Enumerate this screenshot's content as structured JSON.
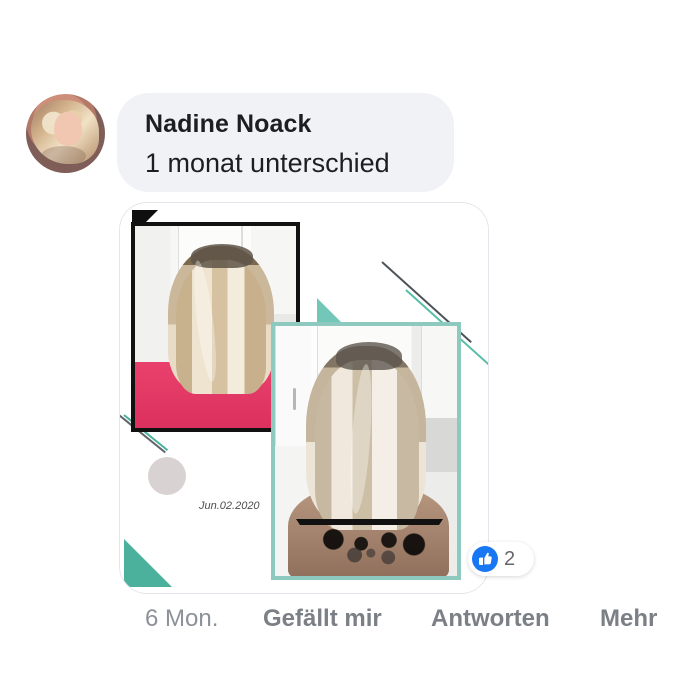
{
  "comment": {
    "author": "Nadine Noack",
    "text": "1 monat unterschied"
  },
  "attachment": {
    "date_label": "Jun.02.2020"
  },
  "reaction": {
    "icon": "like-icon",
    "count": "2"
  },
  "actions": {
    "time": "6 Mon.",
    "like": "Gefällt mir",
    "reply": "Antworten",
    "more": "Mehr"
  },
  "colors": {
    "bubble_background": "#f0f2f5",
    "text_primary": "#1c1e21",
    "text_secondary": "#7b7f86",
    "accent_blue": "#1877f2",
    "accent_teal": "#4bb19c"
  }
}
